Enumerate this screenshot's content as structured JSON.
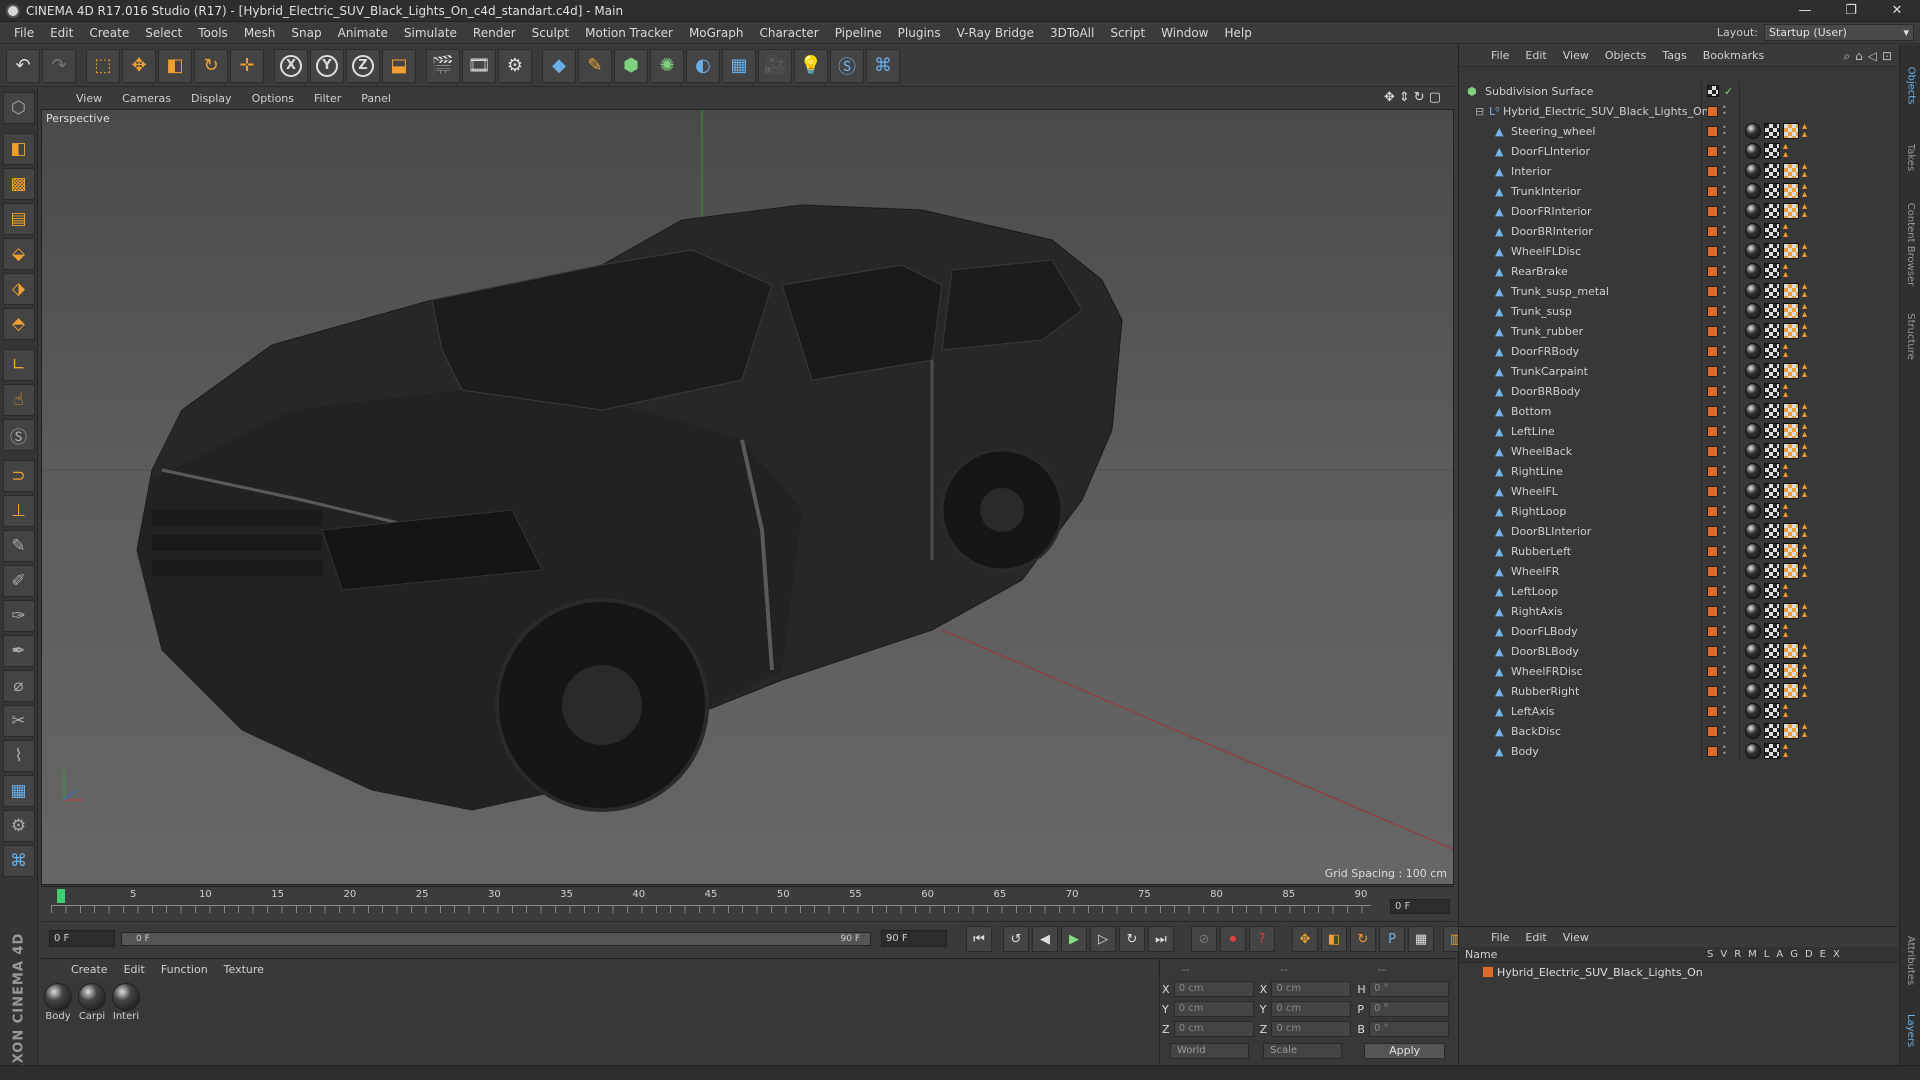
{
  "window": {
    "title": "CINEMA 4D R17.016 Studio (R17) - [Hybrid_Electric_SUV_Black_Lights_On_c4d_standart.c4d] - Main",
    "buttons": [
      "—",
      "❐",
      "✕"
    ]
  },
  "menu": [
    "File",
    "Edit",
    "Create",
    "Select",
    "Tools",
    "Mesh",
    "Snap",
    "Animate",
    "Simulate",
    "Render",
    "Sculpt",
    "Motion Tracker",
    "MoGraph",
    "Character",
    "Pipeline",
    "Plugins",
    "V-Ray Bridge",
    "3DToAll",
    "Script",
    "Window",
    "Help"
  ],
  "layout": {
    "label": "Layout:",
    "value": "Startup (User)"
  },
  "toolbar": {
    "axis_x": "X",
    "axis_y": "Y",
    "axis_z": "Z"
  },
  "viewport": {
    "menu": [
      "View",
      "Cameras",
      "Display",
      "Options",
      "Filter",
      "Panel"
    ],
    "label": "Perspective",
    "grid_spacing": "Grid Spacing : 100 cm"
  },
  "timeline": {
    "ticks": [
      "0",
      "5",
      "10",
      "15",
      "20",
      "25",
      "30",
      "35",
      "40",
      "45",
      "50",
      "55",
      "60",
      "65",
      "70",
      "75",
      "80",
      "85",
      "90"
    ],
    "current_frame": "0 F"
  },
  "transport": {
    "start_field": "0 F",
    "slider_start": "0 F",
    "slider_end": "90 F",
    "end_field": "90 F"
  },
  "materials": {
    "menu": [
      "Create",
      "Edit",
      "Function",
      "Texture"
    ],
    "items": [
      "Body",
      "Carpi",
      "Interi"
    ]
  },
  "coordinates": {
    "head_left": "--",
    "head_mid": "--",
    "head_right": "--",
    "rows": [
      {
        "a1": "X",
        "v1": "0 cm",
        "a2": "X",
        "v2": "0 cm",
        "a3": "H",
        "v3": "0 °"
      },
      {
        "a1": "Y",
        "v1": "0 cm",
        "a2": "Y",
        "v2": "0 cm",
        "a3": "P",
        "v3": "0 °"
      },
      {
        "a1": "Z",
        "v1": "0 cm",
        "a2": "Z",
        "v2": "0 cm",
        "a3": "B",
        "v3": "0 °"
      }
    ],
    "space": "World",
    "mode": "Scale",
    "apply": "Apply"
  },
  "object_manager": {
    "menu": [
      "File",
      "Edit",
      "View",
      "Objects",
      "Tags",
      "Bookmarks"
    ],
    "root": "Subdivision Surface",
    "group": "Hybrid_Electric_SUV_Black_Lights_On",
    "objects": [
      "Steering_wheel",
      "DoorFLInterior",
      "Interior",
      "TrunkInterior",
      "DoorFRInterior",
      "DoorBRInterior",
      "WheelFLDisc",
      "RearBrake",
      "Trunk_susp_metal",
      "Trunk_susp",
      "Trunk_rubber",
      "DoorFRBody",
      "TrunkCarpaint",
      "DoorBRBody",
      "Bottom",
      "LeftLine",
      "WheelBack",
      "RightLine",
      "WheelFL",
      "RightLoop",
      "DoorBLInterior",
      "RubberLeft",
      "WheelFR",
      "LeftLoop",
      "RightAxis",
      "DoorFLBody",
      "DoorBLBody",
      "WheelFRDisc",
      "RubberRight",
      "LeftAxis",
      "BackDisc",
      "Body"
    ]
  },
  "layer_manager": {
    "menu": [
      "File",
      "Edit",
      "View"
    ],
    "name_header": "Name",
    "columns": [
      "S",
      "V",
      "R",
      "M",
      "L",
      "A",
      "G",
      "D",
      "E",
      "X"
    ],
    "row": "Hybrid_Electric_SUV_Black_Lights_On"
  },
  "side_tabs": [
    "Objects",
    "Takes",
    "Content Browser",
    "Structure",
    "Attributes",
    "Layers"
  ]
}
